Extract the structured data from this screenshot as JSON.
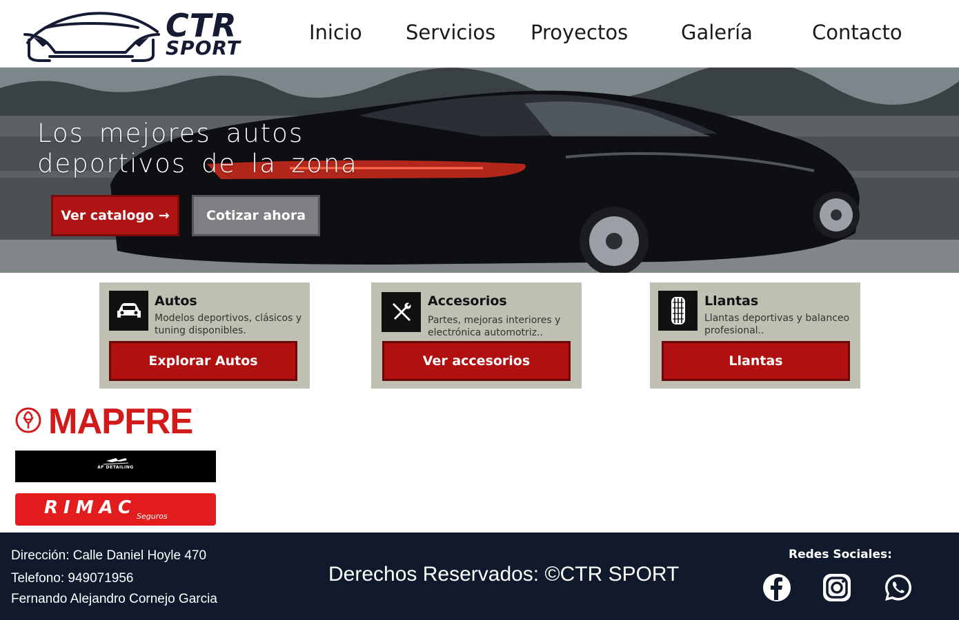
{
  "header": {
    "logo_top": "CTR",
    "logo_bottom": "SPORT",
    "nav": [
      "Inicio",
      "Servicios",
      "Proyectos",
      "Galería",
      "Contacto"
    ]
  },
  "hero": {
    "title": "Los mejores autos\ndeportivos de la zona",
    "primary_button": "Ver catalogo →",
    "secondary_button": "Cotizar ahora"
  },
  "cards": [
    {
      "icon": "car-icon",
      "title": "Autos",
      "description": "Modelos deportivos, clásicos y tuning disponibles.",
      "button": "Explorar Autos"
    },
    {
      "icon": "tools-icon",
      "title": "Accesorios",
      "description": "Partes, mejoras interiores y electrónica automotriz..",
      "button": "Ver accesorios"
    },
    {
      "icon": "tire-icon",
      "title": "Llantas",
      "description": "Llantas deportivas y balanceo profesional..",
      "button": "Llantas"
    }
  ],
  "sponsors": {
    "mapfre": "MAPFRE",
    "af": "AF DETAILING",
    "rimac": "RIMAC",
    "rimac_sub": "Seguros"
  },
  "footer": {
    "address": "Dirección: Calle Daniel Hoyle 470",
    "phone": "Telefono: 949071956",
    "name": "Fernando Alejandro Cornejo Garcia",
    "rights": "Derechos Reservados: ©CTR SPORT",
    "social_title": "Redes Sociales:",
    "social": [
      "facebook-icon",
      "instagram-icon",
      "whatsapp-icon"
    ]
  },
  "colors": {
    "accent_red": "#b01010",
    "footer_bg": "#101a2c",
    "card_bg": "#bfbfb2",
    "logo_navy": "#141b33"
  }
}
